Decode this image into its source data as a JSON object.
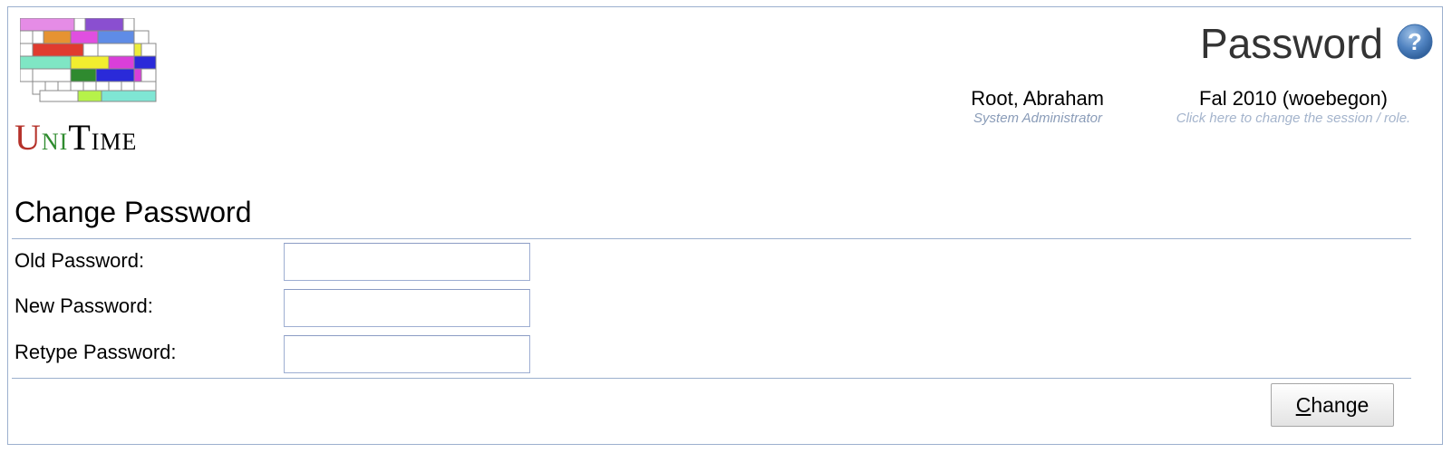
{
  "header": {
    "logo_word": {
      "u": "U",
      "ni": "NI",
      "t": "T",
      "ime": "IME"
    },
    "page_title": "Password",
    "user": {
      "name": "Root, Abraham",
      "role": "System Administrator"
    },
    "session": {
      "name": "Fal 2010 (woebegon)",
      "hint": "Click here to change the session / role."
    }
  },
  "section": {
    "title": "Change Password"
  },
  "form": {
    "old_password": {
      "label": "Old Password:",
      "value": ""
    },
    "new_password": {
      "label": "New Password:",
      "value": ""
    },
    "retype_password": {
      "label": "Retype Password:",
      "value": ""
    }
  },
  "actions": {
    "change_accesskey": "C",
    "change_rest": "hange"
  },
  "colors": {
    "border": "#9cb0ce",
    "role_text": "#8a9cb8",
    "hint_text": "#a4b4cc",
    "logo_u": "#b5322a",
    "logo_n": "#2e8b2e",
    "logo_i": "#2a3cb5"
  },
  "icons": {
    "help": "question-circle-icon",
    "logo": "unitime-timetable-grid-logo"
  }
}
